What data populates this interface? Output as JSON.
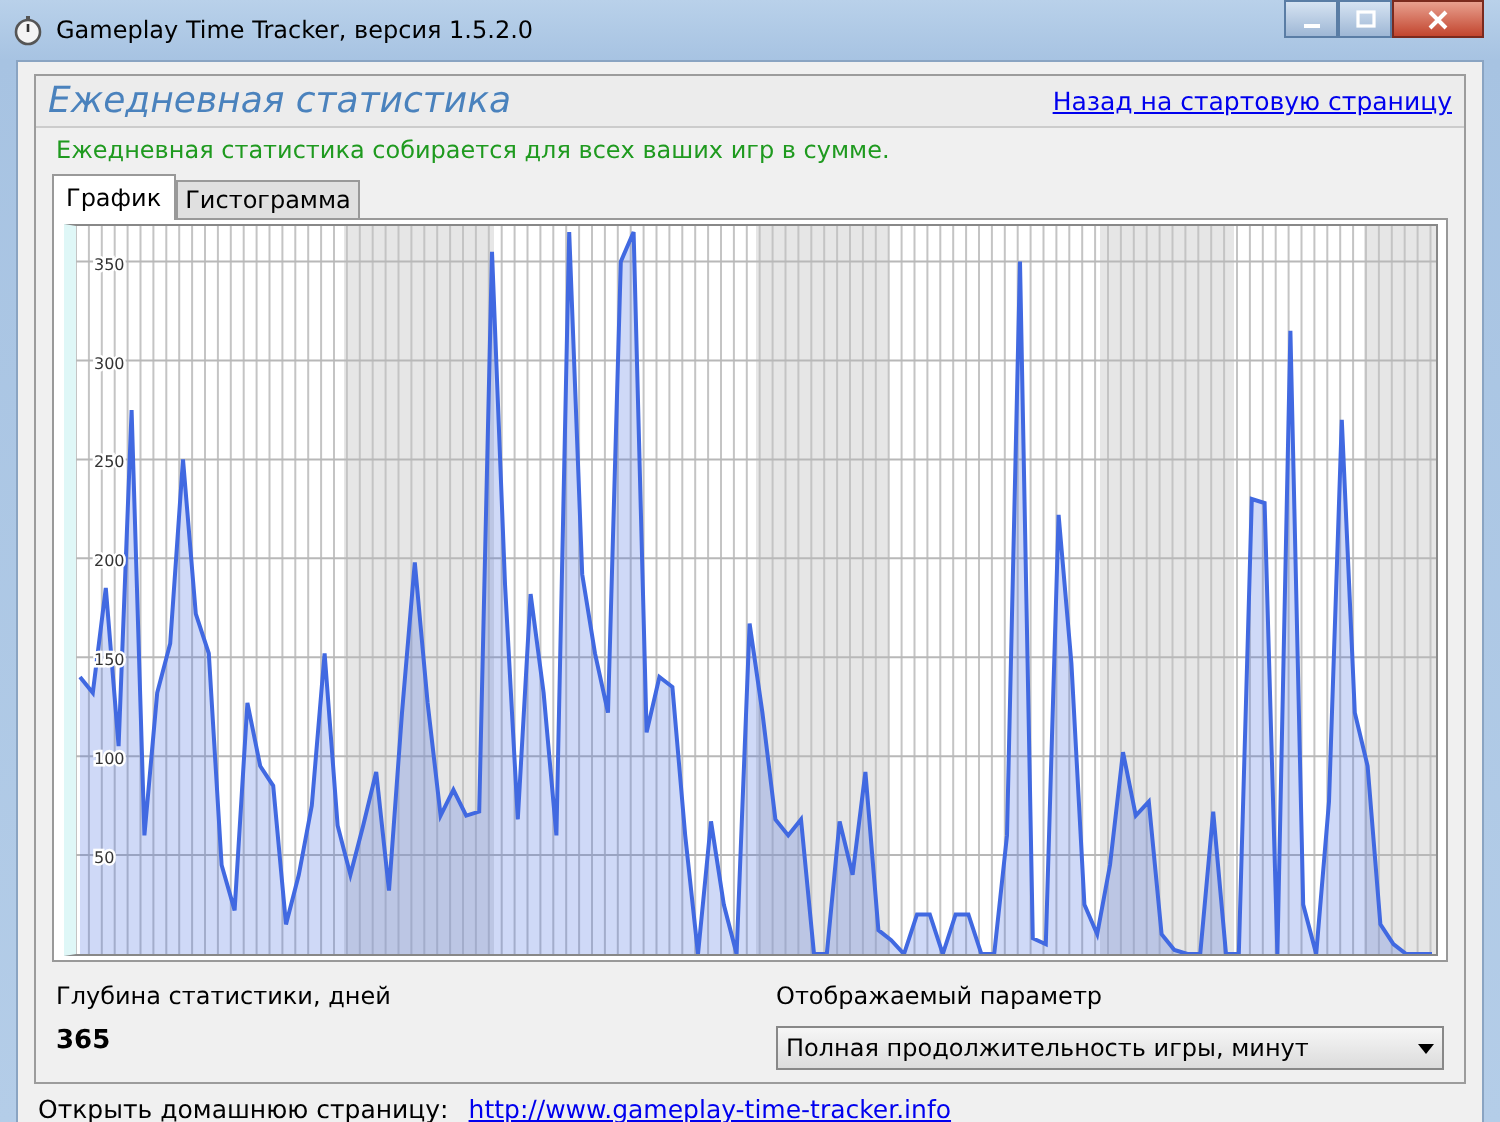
{
  "window": {
    "title": "Gameplay Time Tracker, версия 1.5.2.0"
  },
  "header": {
    "title": "Ежедневная статистика",
    "back_link": "Назад на стартовую страницу"
  },
  "info": "Ежедневная статистика собирается для всех ваших игр в сумме.",
  "tabs": [
    {
      "label": "График",
      "selected": true
    },
    {
      "label": "Гистограмма",
      "selected": false
    }
  ],
  "chart_data": {
    "type": "area",
    "grid": true,
    "ylim": [
      0,
      368
    ],
    "yticks": [
      50,
      100,
      150,
      200,
      250,
      300,
      350
    ],
    "series": [
      {
        "color": "#4169e1",
        "values": [
          140,
          132,
          185,
          105,
          275,
          60,
          132,
          157,
          250,
          172,
          152,
          45,
          22,
          127,
          95,
          85,
          15,
          40,
          75,
          152,
          65,
          40,
          65,
          92,
          32,
          122,
          198,
          127,
          70,
          83,
          70,
          72,
          355,
          187,
          68,
          182,
          132,
          60,
          365,
          192,
          152,
          122,
          350,
          365,
          112,
          140,
          135,
          60,
          0,
          67,
          25,
          0,
          167,
          122,
          68,
          60,
          68,
          0,
          0,
          67,
          40,
          92,
          12,
          7,
          0,
          20,
          20,
          0,
          20,
          20,
          0,
          0,
          60,
          350,
          8,
          5,
          222,
          147,
          25,
          10,
          45,
          102,
          70,
          77,
          10,
          2,
          0,
          0,
          72,
          0,
          0,
          230,
          228,
          0,
          315,
          25,
          0,
          77,
          270,
          122,
          95,
          15,
          5,
          0,
          0,
          0
        ]
      }
    ]
  },
  "depth": {
    "label": "Глубина статистики, дней",
    "value": "365"
  },
  "parameter": {
    "label": "Отображаемый параметр",
    "value": "Полная продолжительность игры, минут"
  },
  "status_bar": {
    "label": "Открыть домашнюю страницу:",
    "link": "http://www.gameplay-time-tracker.info"
  }
}
